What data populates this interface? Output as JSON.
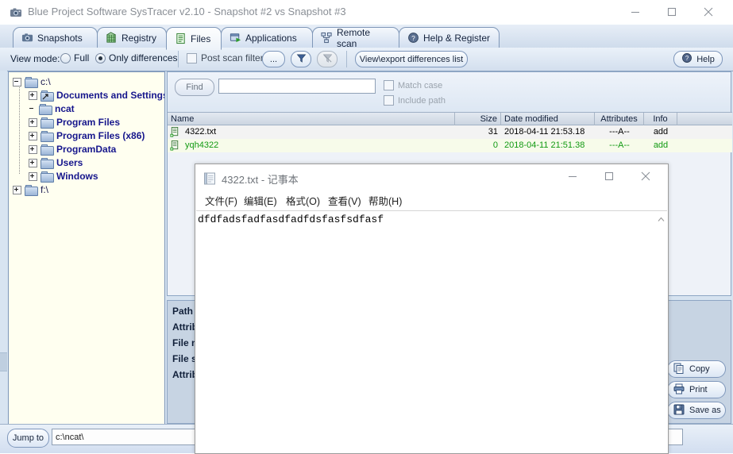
{
  "window": {
    "title": "Blue Project Software SysTracer v2.10 - Snapshot #2 vs Snapshot #3",
    "icon": "camera-icon",
    "minimize": "minimize-icon",
    "maximize": "maximize-icon",
    "close": "close-icon"
  },
  "tabs": [
    {
      "label": "Snapshots",
      "icon": "camera-icon",
      "active": false
    },
    {
      "label": "Registry",
      "icon": "registry-icon",
      "active": false
    },
    {
      "label": "Files",
      "icon": "files-icon",
      "active": true
    },
    {
      "label": "Applications",
      "icon": "application-icon",
      "active": false
    },
    {
      "label": "Remote scan",
      "icon": "network-icon",
      "active": false
    },
    {
      "label": "Help & Register",
      "icon": "help-icon",
      "active": false
    }
  ],
  "toolbar": {
    "view_mode_label": "View mode:",
    "radio_full": "Full",
    "radio_only_differences": "Only differences",
    "selected_view_mode": "Only differences",
    "post_scan_filter": "Post scan filter",
    "post_scan_filter_checked": false,
    "ellipsis_button": "...",
    "filter_button": "funnel-icon",
    "clear_filter_button": "clear-funnel-icon",
    "view_export": "View\\export differences list",
    "help_button": "Help",
    "help_icon": "help-globe-icon"
  },
  "tree": {
    "nodes": [
      {
        "label": "c:\\",
        "indent": 0,
        "expander": "minus",
        "icon": "folder-icon",
        "style": "root"
      },
      {
        "label": "Documents and Settings",
        "indent": 1,
        "expander": "plus",
        "icon": "shortcut-folder-icon",
        "style": "bold"
      },
      {
        "label": "ncat",
        "indent": 1,
        "expander": "none",
        "icon": "folder-icon",
        "style": "bold"
      },
      {
        "label": "Program Files",
        "indent": 1,
        "expander": "plus",
        "icon": "folder-icon",
        "style": "bold"
      },
      {
        "label": "Program Files (x86)",
        "indent": 1,
        "expander": "plus",
        "icon": "folder-icon",
        "style": "bold"
      },
      {
        "label": "ProgramData",
        "indent": 1,
        "expander": "plus",
        "icon": "folder-icon",
        "style": "bold"
      },
      {
        "label": "Users",
        "indent": 1,
        "expander": "plus",
        "icon": "folder-icon",
        "style": "bold"
      },
      {
        "label": "Windows",
        "indent": 1,
        "expander": "plus",
        "icon": "folder-icon",
        "style": "bold"
      },
      {
        "label": "f:\\",
        "indent": 0,
        "expander": "plus",
        "icon": "folder-icon",
        "style": "root"
      }
    ]
  },
  "find": {
    "button": "Find",
    "input_value": "",
    "input_placeholder": "",
    "match_case": "Match case",
    "match_case_checked": false,
    "include_path": "Include path",
    "include_path_checked": false
  },
  "filelist": {
    "columns": [
      "Name",
      "Size",
      "Date modified",
      "Attributes",
      "Info"
    ],
    "rows": [
      {
        "name": "4322.txt",
        "size": "31",
        "date": "2018-04-11 21:53.18",
        "attributes": "---A--",
        "info": "add",
        "color": "#000000",
        "icon": "file-add-icon"
      },
      {
        "name": "yqh4322",
        "size": "0",
        "date": "2018-04-11 21:51.38",
        "attributes": "---A--",
        "info": "add",
        "color": "#129a12",
        "icon": "file-add-icon"
      }
    ]
  },
  "details": {
    "labels": [
      "Path",
      "Attrib",
      "File n",
      "File s",
      "Attrib"
    ],
    "buttons": [
      {
        "label": "Copy",
        "icon": "copy-icon"
      },
      {
        "label": "Print",
        "icon": "printer-icon"
      },
      {
        "label": "Save as",
        "icon": "save-icon"
      }
    ]
  },
  "bottom": {
    "jump_to": "Jump to",
    "path_value": "c:\\ncat\\",
    "path_placeholder": ""
  },
  "notepad": {
    "title": "4322.txt - 记事本",
    "icon": "notepad-icon",
    "menu": [
      {
        "label": "文件(F)",
        "accel": "F"
      },
      {
        "label": "编辑(E)",
        "accel": "E"
      },
      {
        "label": "格式(O)",
        "accel": "O"
      },
      {
        "label": "查看(V)",
        "accel": "V"
      },
      {
        "label": "帮助(H)",
        "accel": "H"
      }
    ],
    "content": "dfdfadsfadfasdfadfdsfasfsdfasf",
    "minimize": "minimize-icon",
    "maximize": "maximize-icon",
    "close": "close-icon",
    "scroll_up": "scroll-up-arrow"
  },
  "colors": {
    "accent": "#7f97bb",
    "added_green": "#129a12",
    "tree_text": "#2c2c9c",
    "panel_bg": "#d6e3f0"
  }
}
